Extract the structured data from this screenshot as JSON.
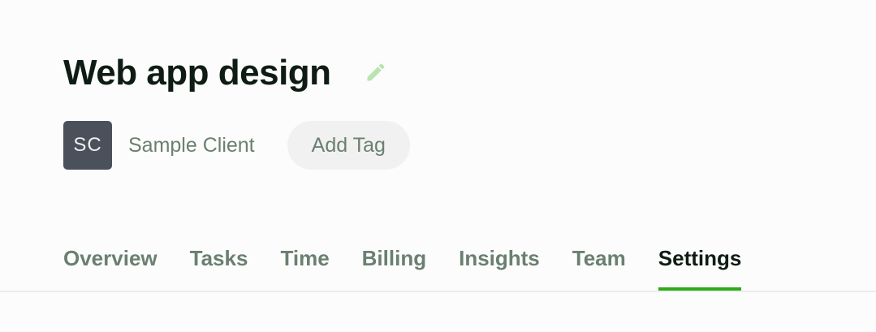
{
  "project": {
    "title": "Web app design",
    "edit_icon": "pencil-icon"
  },
  "client": {
    "initials": "SC",
    "name": "Sample Client"
  },
  "add_tag_label": "Add Tag",
  "tabs": [
    {
      "label": "Overview",
      "active": false
    },
    {
      "label": "Tasks",
      "active": false
    },
    {
      "label": "Time",
      "active": false
    },
    {
      "label": "Billing",
      "active": false
    },
    {
      "label": "Insights",
      "active": false
    },
    {
      "label": "Team",
      "active": false
    },
    {
      "label": "Settings",
      "active": true
    }
  ],
  "colors": {
    "title": "#0f1c14",
    "muted_text": "#6a8070",
    "accent": "#2eaa19",
    "edit_icon": "#b9e4b0",
    "avatar_bg": "#4b515a"
  }
}
